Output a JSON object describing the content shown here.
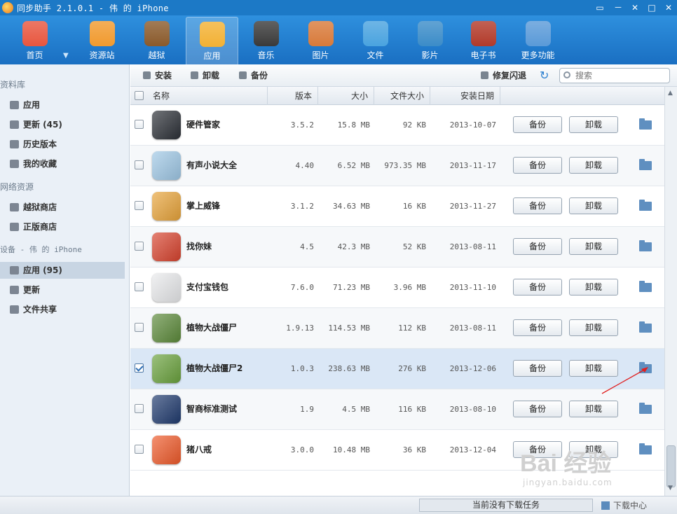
{
  "window": {
    "title": "同步助手 2.1.0.1 - 伟 的 iPhone",
    "controls": [
      "▭",
      "－",
      "✕",
      "□",
      "✕"
    ]
  },
  "nav": [
    {
      "label": "首页",
      "icon": "home-icon",
      "color": "#e8563f"
    },
    {
      "label": "资源站",
      "icon": "shopping-bag-icon",
      "color": "#f19a2e"
    },
    {
      "label": "越狱",
      "icon": "jailbreak-icon",
      "color": "#8a5a2b"
    },
    {
      "label": "应用",
      "icon": "apps-icon",
      "color": "#f2b134"
    },
    {
      "label": "音乐",
      "icon": "music-icon",
      "color": "#3a3a3a"
    },
    {
      "label": "图片",
      "icon": "photo-icon",
      "color": "#d87a3a"
    },
    {
      "label": "文件",
      "icon": "file-icon",
      "color": "#4aa3df"
    },
    {
      "label": "影片",
      "icon": "video-icon",
      "color": "#3b8cc8"
    },
    {
      "label": "电子书",
      "icon": "ebook-icon",
      "color": "#b23a2a"
    },
    {
      "label": "更多功能",
      "icon": "tools-icon",
      "color": "#5a9ad8"
    }
  ],
  "sidebar": {
    "sections": [
      "资料库",
      "网络资源",
      "设备 - 伟 的 iPhone"
    ],
    "library": [
      "应用",
      "更新 (45)",
      "历史版本",
      "我的收藏"
    ],
    "network": [
      "越狱商店",
      "正版商店"
    ],
    "device": [
      "应用 (95)",
      "更新",
      "文件共享"
    ]
  },
  "actions": {
    "install": "安装",
    "uninstall": "卸载",
    "backup": "备份",
    "repair": "修复闪退",
    "search_placeholder": "搜索"
  },
  "table": {
    "headers": {
      "name": "名称",
      "version": "版本",
      "size": "大小",
      "filesize": "文件大小",
      "date": "安装日期"
    },
    "backup_label": "备份",
    "uninstall_label": "卸载",
    "rows": [
      {
        "name": "硬件管家",
        "version": "3.5.2",
        "size": "15.8 MB",
        "filesize": "92 KB",
        "date": "2013-10-07",
        "checked": false,
        "icon_color": "#2b2f36"
      },
      {
        "name": "有声小说大全",
        "version": "4.40",
        "size": "6.52 MB",
        "filesize": "973.35 MB",
        "date": "2013-11-17",
        "checked": false,
        "icon_color": "#9fc8e6"
      },
      {
        "name": "掌上威锋",
        "version": "3.1.2",
        "size": "34.63 MB",
        "filesize": "16 KB",
        "date": "2013-11-27",
        "checked": false,
        "icon_color": "#e8a43a"
      },
      {
        "name": "找你妹",
        "version": "4.5",
        "size": "42.3 MB",
        "filesize": "52 KB",
        "date": "2013-08-11",
        "checked": false,
        "icon_color": "#d8432e"
      },
      {
        "name": "支付宝钱包",
        "version": "7.6.0",
        "size": "71.23 MB",
        "filesize": "3.96 MB",
        "date": "2013-11-10",
        "checked": false,
        "icon_color": "#e9eaec"
      },
      {
        "name": "植物大战僵尸",
        "version": "1.9.13",
        "size": "114.53 MB",
        "filesize": "112 KB",
        "date": "2013-08-11",
        "checked": false,
        "icon_color": "#5c8a3a"
      },
      {
        "name": "植物大战僵尸2",
        "version": "1.0.3",
        "size": "238.63 MB",
        "filesize": "276 KB",
        "date": "2013-12-06",
        "checked": true,
        "icon_color": "#6aa23d"
      },
      {
        "name": "智商标准测试",
        "version": "1.9",
        "size": "4.5 MB",
        "filesize": "116 KB",
        "date": "2013-08-10",
        "checked": false,
        "icon_color": "#1f3a6e"
      },
      {
        "name": "猪八戒",
        "version": "3.0.0",
        "size": "10.48 MB",
        "filesize": "36 KB",
        "date": "2013-12-04",
        "checked": false,
        "icon_color": "#ef5a2a"
      }
    ]
  },
  "status": {
    "download": "当前没有下载任务",
    "center": "下载中心"
  },
  "watermark": {
    "brand": "Bai 经验",
    "url": "jingyan.baidu.com"
  }
}
